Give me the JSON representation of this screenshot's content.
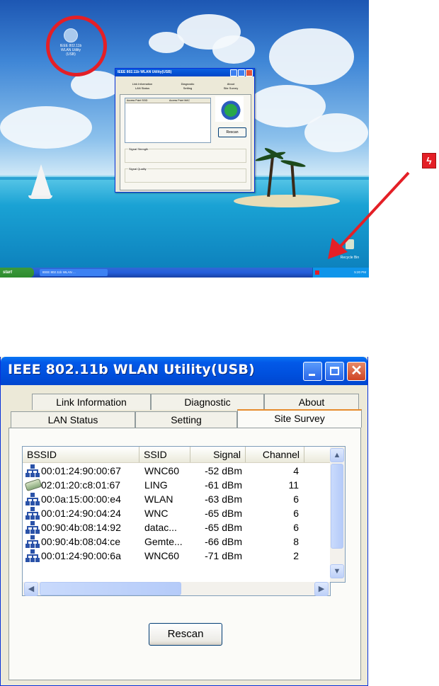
{
  "desktop": {
    "icon_label": "IEEE 802.11b\nWLAN Utility\n(USB)",
    "recycle_label": "Recycle Bin",
    "start_label": "start",
    "taskbar_item": "IEEE 802.11b WLAN ...",
    "clock": "5:20 PM",
    "mini_dialog": {
      "title": "IEEE 802.11b WLAN Utility(USB)",
      "tabs": [
        "Link Information",
        "Diagnostic",
        "About",
        "LAN Status",
        "Setting",
        "Site Survey"
      ],
      "list_headers": [
        "Access Point SSID",
        "Access Point MAC"
      ],
      "rescan_label": "Rescan",
      "signal_strength_label": "Signal Strength",
      "signal_quality_label": "Signal Quality"
    }
  },
  "window": {
    "title": "IEEE 802.11b WLAN Utility(USB)",
    "tabs_back": [
      {
        "label": "Link Information"
      },
      {
        "label": "Diagnostic"
      },
      {
        "label": "About"
      }
    ],
    "tabs_front": [
      {
        "label": "LAN Status"
      },
      {
        "label": "Setting"
      },
      {
        "label": "Site Survey",
        "selected": true
      }
    ],
    "list": {
      "columns": [
        "BSSID",
        "SSID",
        "Signal",
        "Channel"
      ],
      "rows": [
        {
          "icon": "access-point-icon",
          "bssid": "00:01:24:90:00:67",
          "ssid": "WNC60",
          "signal": "-52 dBm",
          "channel": "4"
        },
        {
          "icon": "adhoc-card-icon",
          "bssid": "02:01:20:c8:01:67",
          "ssid": "LING",
          "signal": "-61 dBm",
          "channel": "11"
        },
        {
          "icon": "access-point-icon",
          "bssid": "00:0a:15:00:00:e4",
          "ssid": "WLAN",
          "signal": "-63 dBm",
          "channel": "6"
        },
        {
          "icon": "access-point-icon",
          "bssid": "00:01:24:90:04:24",
          "ssid": "WNC",
          "signal": "-65 dBm",
          "channel": "6"
        },
        {
          "icon": "access-point-icon",
          "bssid": "00:90:4b:08:14:92",
          "ssid": "datac...",
          "signal": "-65 dBm",
          "channel": "6"
        },
        {
          "icon": "access-point-icon",
          "bssid": "00:90:4b:08:04:ce",
          "ssid": "Gemte...",
          "signal": "-66 dBm",
          "channel": "8"
        },
        {
          "icon": "access-point-icon",
          "bssid": "00:01:24:90:00:6a",
          "ssid": "WNC60",
          "signal": "-71 dBm",
          "channel": "2"
        }
      ]
    },
    "rescan_label": "Rescan"
  },
  "colors": {
    "title_blue": "#0050de",
    "annotation_red": "#e41f26",
    "tab_highlight": "#e68b2c"
  }
}
